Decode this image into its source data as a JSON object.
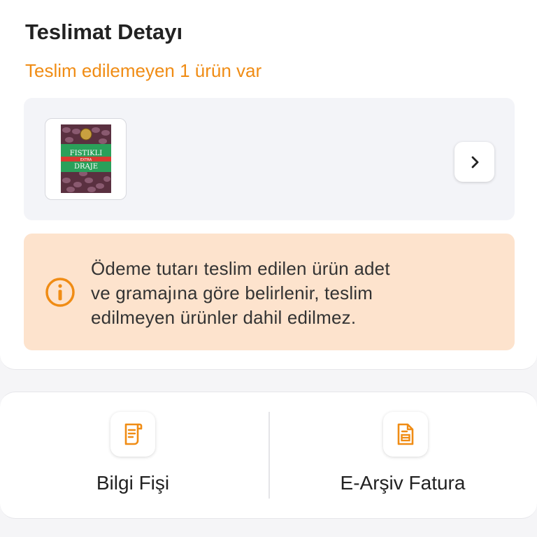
{
  "delivery": {
    "title": "Teslimat Detayı",
    "subtitle": "Teslim edilemeyen 1 ürün var",
    "product": {
      "image_icon": "product-thumbnail",
      "package_text": [
        "FISTIKLI",
        "EXTRA",
        "DRAJE"
      ]
    },
    "info": {
      "icon": "info-circle-icon",
      "lines": [
        "Ödeme tutarı teslim edilen ürün adet",
        "ve gramajına göre belirlenir, teslim",
        "edilmeyen ürünler dahil edilmez."
      ]
    }
  },
  "actions": [
    {
      "label": "Bilgi Fişi",
      "icon": "receipt-icon"
    },
    {
      "label": "E-Arşiv Fatura",
      "icon": "invoice-icon"
    }
  ],
  "colors": {
    "accent": "#f08c14",
    "info_bg": "#fde3cd",
    "product_bg": "#f3f4f8"
  }
}
